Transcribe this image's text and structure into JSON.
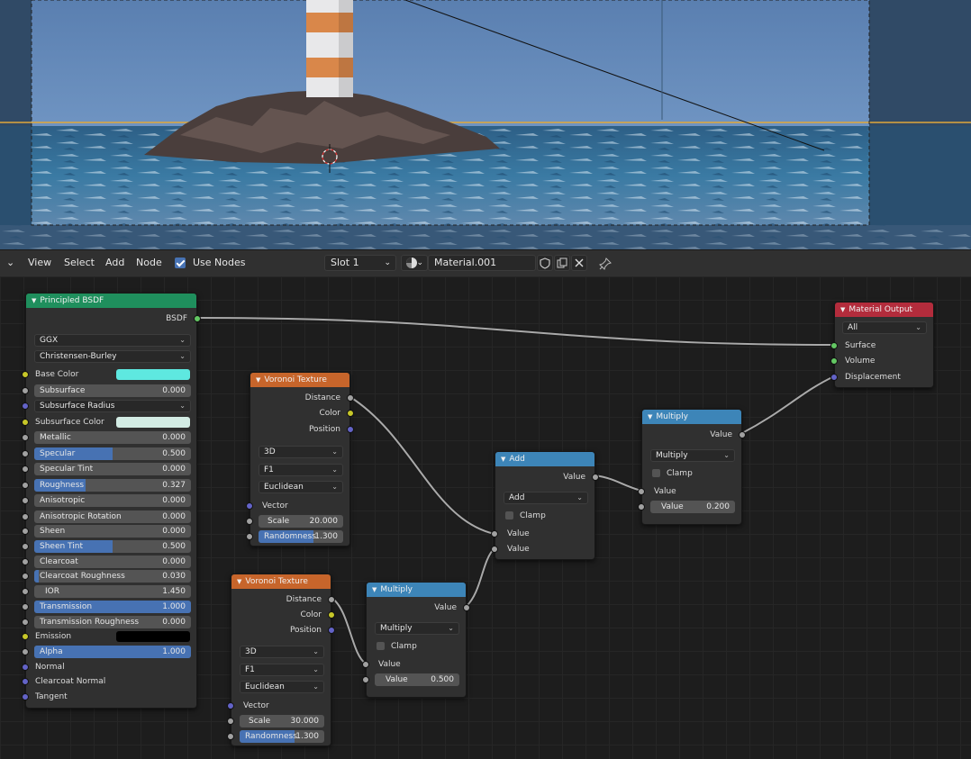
{
  "header": {
    "menu": [
      "View",
      "Select",
      "Add",
      "Node"
    ],
    "use_nodes_label": "Use Nodes",
    "slot": "Slot 1",
    "material_name": "Material.001"
  },
  "nodes": {
    "principled": {
      "title": "Principled BSDF",
      "output": "BSDF",
      "distribution": "GGX",
      "subsurface_method": "Christensen-Burley",
      "base_color_label": "Base Color",
      "base_color": "#5ee8e0",
      "subsurface_label": "Subsurface",
      "subsurface": "0.000",
      "subsurface_radius_label": "Subsurface Radius",
      "subsurface_color_label": "Subsurface Color",
      "subsurface_color": "#d3ece4",
      "metallic_label": "Metallic",
      "metallic": "0.000",
      "specular_label": "Specular",
      "specular": "0.500",
      "specular_tint_label": "Specular Tint",
      "specular_tint": "0.000",
      "roughness_label": "Roughness",
      "roughness": "0.327",
      "anisotropic_label": "Anisotropic",
      "anisotropic": "0.000",
      "anisotropic_rotation_label": "Anisotropic Rotation",
      "anisotropic_rotation": "0.000",
      "sheen_label": "Sheen",
      "sheen": "0.000",
      "sheen_tint_label": "Sheen Tint",
      "sheen_tint": "0.500",
      "clearcoat_label": "Clearcoat",
      "clearcoat": "0.000",
      "clearcoat_roughness_label": "Clearcoat Roughness",
      "clearcoat_roughness": "0.030",
      "ior_label": "IOR",
      "ior": "1.450",
      "transmission_label": "Transmission",
      "transmission": "1.000",
      "transmission_roughness_label": "Transmission Roughness",
      "transmission_roughness": "0.000",
      "emission_label": "Emission",
      "emission_color": "#000000",
      "alpha_label": "Alpha",
      "alpha": "1.000",
      "normal_label": "Normal",
      "clearcoat_normal_label": "Clearcoat Normal",
      "tangent_label": "Tangent"
    },
    "voronoi1": {
      "title": "Voronoi Texture",
      "distance": "Distance",
      "color": "Color",
      "position": "Position",
      "dimensions": "3D",
      "feature": "F1",
      "metric": "Euclidean",
      "vector": "Vector",
      "scale_label": "Scale",
      "scale": "20.000",
      "randomness_label": "Randomness",
      "randomness": "1.300"
    },
    "voronoi2": {
      "title": "Voronoi Texture",
      "distance": "Distance",
      "color": "Color",
      "position": "Position",
      "dimensions": "3D",
      "feature": "F1",
      "metric": "Euclidean",
      "vector": "Vector",
      "scale_label": "Scale",
      "scale": "30.000",
      "randomness_label": "Randomness",
      "randomness": "1.300"
    },
    "add": {
      "title": "Add",
      "output": "Value",
      "operation": "Add",
      "clamp": "Clamp",
      "input1": "Value",
      "input2": "Value"
    },
    "multiply1": {
      "title": "Multiply",
      "output": "Value",
      "operation": "Multiply",
      "clamp": "Clamp",
      "input1": "Value",
      "value_label": "Value",
      "value": "0.500"
    },
    "multiply2": {
      "title": "Multiply",
      "output": "Value",
      "operation": "Multiply",
      "clamp": "Clamp",
      "input1": "Value",
      "value_label": "Value",
      "value": "0.200"
    },
    "output": {
      "title": "Material Output",
      "target": "All",
      "surface": "Surface",
      "volume": "Volume",
      "displacement": "Displacement"
    }
  },
  "fractions": {
    "specular": 0.5,
    "roughness": 0.327,
    "sheen_tint": 0.5,
    "clearcoat_roughness": 0.03,
    "transmission": 1.0,
    "alpha": 1.0,
    "randomness": 0.65
  }
}
